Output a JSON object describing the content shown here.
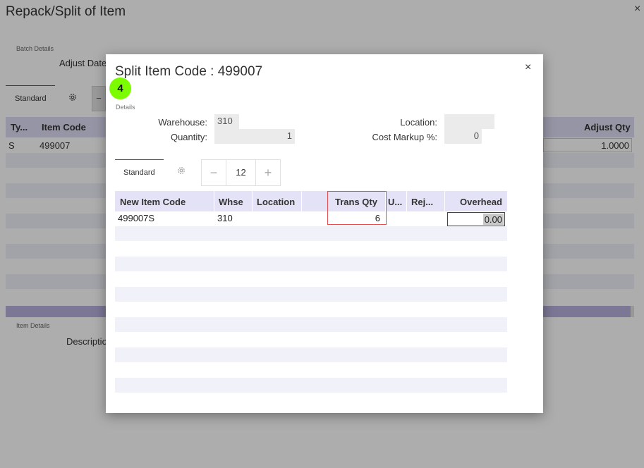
{
  "background": {
    "title": "Repack/Split of Item",
    "close_glyph": "×",
    "batch_section_label": "Batch Details",
    "adjust_date_label": "Adjust Date",
    "tab_label": "Standard",
    "stepper_minus": "−",
    "grid": {
      "headers": [
        "Ty...",
        "Item Code",
        "Adjust Qty"
      ],
      "row": {
        "type": "S",
        "item_code": "499007",
        "adjust_qty": "1.0000"
      }
    },
    "item_section_label": "Item Details",
    "description_label": "Description"
  },
  "modal": {
    "title": "Split Item Code : 499007",
    "close_glyph": "×",
    "step_badge": "4",
    "section_label": "Details",
    "fields": {
      "warehouse_label": "Warehouse:",
      "warehouse_value": "310",
      "quantity_label": "Quantity:",
      "quantity_value": "1",
      "location_label": "Location:",
      "location_value": "",
      "cost_markup_label": "Cost Markup %:",
      "cost_markup_value": "0"
    },
    "tab_label": "Standard",
    "stepper": {
      "minus": "−",
      "value": "12",
      "plus": "+"
    },
    "grid": {
      "headers": [
        "New Item Code",
        "Whse",
        "Location",
        "",
        "Trans Qty",
        "U...",
        "Rej...",
        "Overhead"
      ],
      "rows": [
        {
          "new_item_code": "499007S",
          "whse": "310",
          "location": "",
          "trans_qty": "6",
          "uom": "",
          "rej": "",
          "overhead": "0.00"
        }
      ]
    }
  },
  "icons": {
    "gear": "gear-icon",
    "close": "close-icon",
    "minus": "minus-icon",
    "plus": "plus-icon"
  },
  "colors": {
    "grid_header_bg": "#e4e2f6",
    "step_badge": "#7cfc00",
    "highlight": "#e05050"
  }
}
